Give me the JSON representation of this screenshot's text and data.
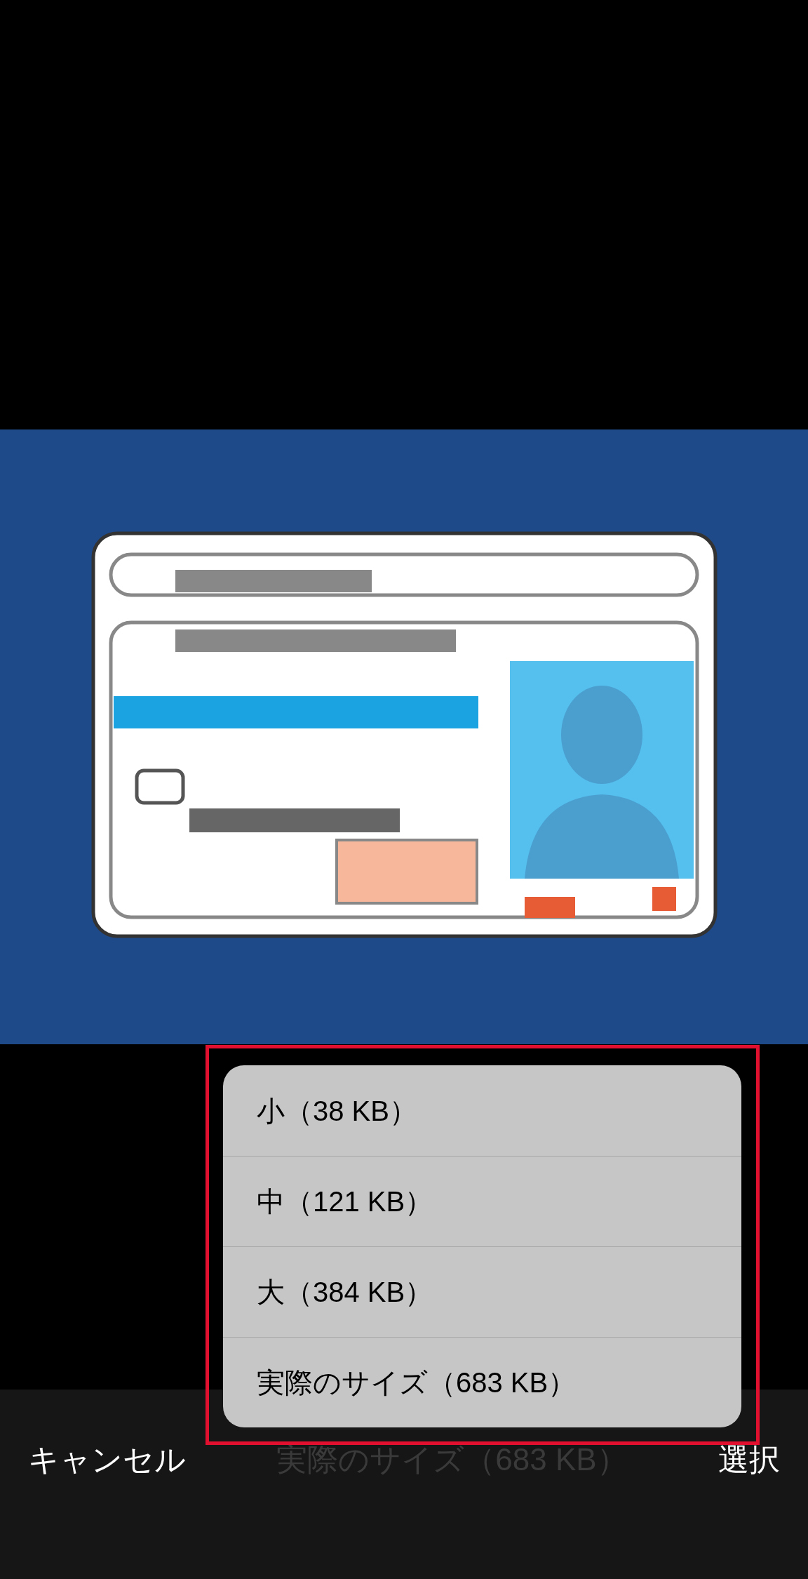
{
  "size_menu": {
    "items": [
      {
        "label": "小（38 KB）"
      },
      {
        "label": "中（121 KB）"
      },
      {
        "label": "大（384 KB）"
      },
      {
        "label": "実際のサイズ（683 KB）"
      }
    ]
  },
  "bottom_bar": {
    "cancel": "キャンセル",
    "current_size": {
      "label": "実際のサイズ（683 KB）",
      "dimmed": true
    },
    "select": "選択"
  }
}
